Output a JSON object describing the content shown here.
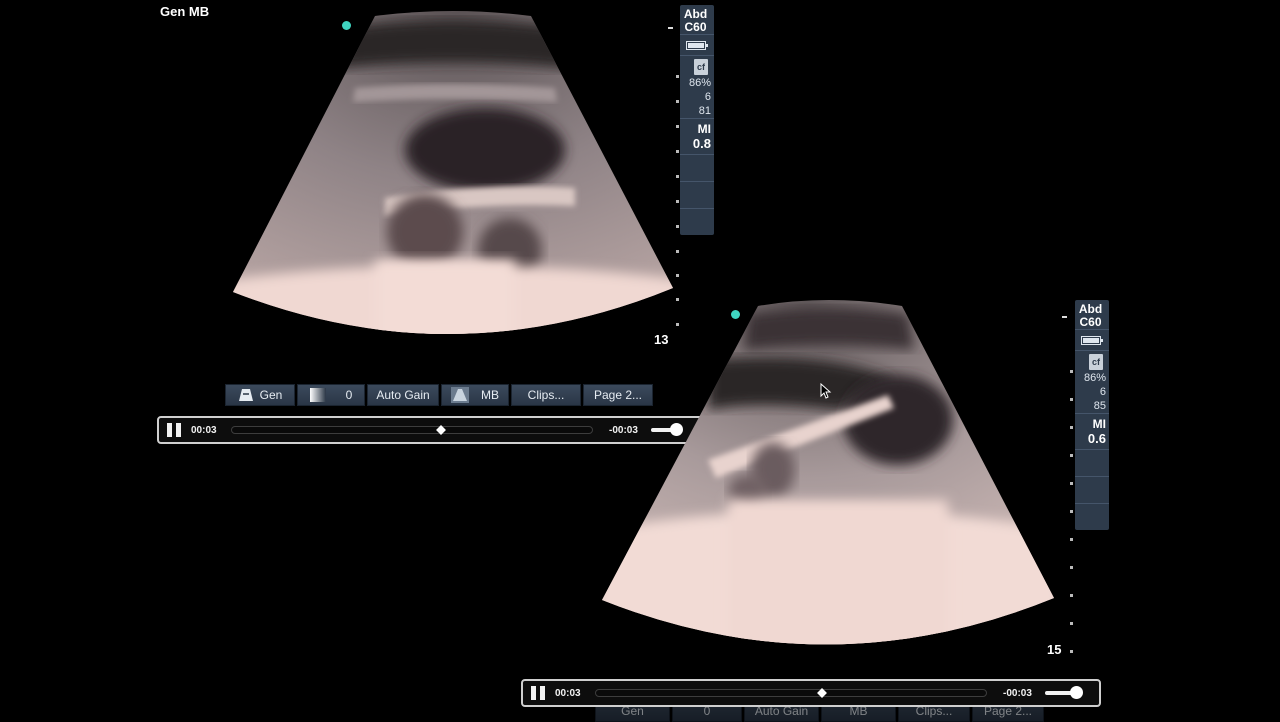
{
  "top_left_label": "Gen MB",
  "panel_top": {
    "probe_line1": "Abd",
    "probe_line2": "C60",
    "cf_badge": "cf",
    "cf_percent": "86%",
    "cf_val1": "6",
    "cf_val2": "81",
    "mi_label": "MI",
    "mi_value": "0.8",
    "depth": "13"
  },
  "panel_bottom": {
    "probe_line1": "Abd",
    "probe_line2": "C60",
    "cf_badge": "cf",
    "cf_percent": "86%",
    "cf_val1": "6",
    "cf_val2": "85",
    "mi_label": "MI",
    "mi_value": "0.6",
    "depth": "15"
  },
  "toolbar": {
    "gen_label": "Gen",
    "gain_value": "0",
    "auto_gain_label": "Auto Gain",
    "mb_label": "MB",
    "clips_label": "Clips...",
    "page2_label": "Page 2..."
  },
  "player_top": {
    "elapsed": "00:03",
    "remaining": "-00:03",
    "progress": 0.58,
    "volume": 1.0
  },
  "player_bottom": {
    "elapsed": "00:03",
    "remaining": "-00:03",
    "progress": 0.58,
    "volume": 1.0
  },
  "toolbar_bottom_partial": {
    "gen_label": "Gen",
    "gain_value": "0",
    "auto_gain_label": "Auto Gain",
    "mb_label": "MB",
    "clips_label": "Clips...",
    "page2_label": "Page 2..."
  },
  "colors": {
    "background": "#000000",
    "panel": "#2e3b4b",
    "marker": "#3fd4c0",
    "tissue_bright": "#f0d8d2"
  }
}
